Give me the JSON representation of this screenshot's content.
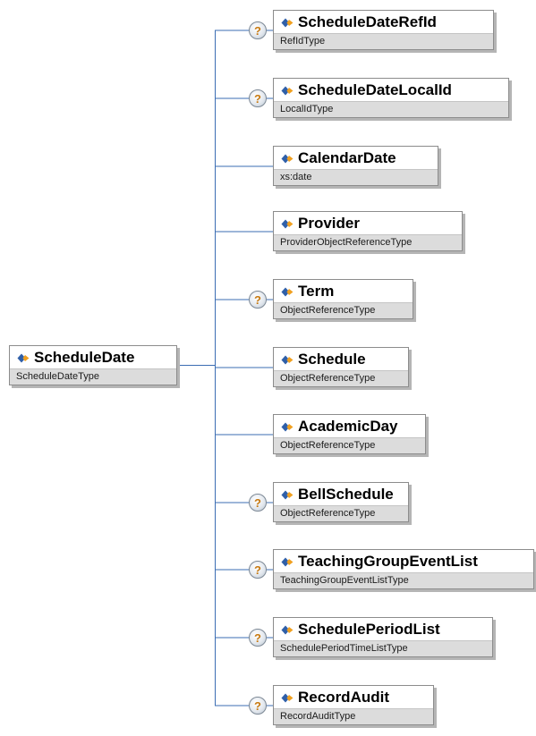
{
  "root": {
    "name": "ScheduleDate",
    "type": "ScheduleDateType",
    "icon": "element-diamond-icon"
  },
  "children": [
    {
      "name": "ScheduleDateRefId",
      "type": "RefIdType",
      "optional": true
    },
    {
      "name": "ScheduleDateLocalId",
      "type": "LocalIdType",
      "optional": true
    },
    {
      "name": "CalendarDate",
      "type": "xs:date",
      "optional": false
    },
    {
      "name": "Provider",
      "type": "ProviderObjectReferenceType",
      "optional": false
    },
    {
      "name": "Term",
      "type": "ObjectReferenceType",
      "optional": true
    },
    {
      "name": "Schedule",
      "type": "ObjectReferenceType",
      "optional": false
    },
    {
      "name": "AcademicDay",
      "type": "ObjectReferenceType",
      "optional": false
    },
    {
      "name": "BellSchedule",
      "type": "ObjectReferenceType",
      "optional": true
    },
    {
      "name": "TeachingGroupEventList",
      "type": "TeachingGroupEventListType",
      "optional": true
    },
    {
      "name": "SchedulePeriodList",
      "type": "SchedulePeriodTimeListType",
      "optional": true
    },
    {
      "name": "RecordAudit",
      "type": "RecordAuditType",
      "optional": true
    }
  ],
  "optional_marker": "?",
  "colors": {
    "border": "#8c8c8c",
    "type_band": "#dcdcdc",
    "connector": "#3b6db3",
    "icon_blue": "#2f5fa8",
    "icon_orange": "#f0a020",
    "optional_mark": "#c77a12"
  }
}
